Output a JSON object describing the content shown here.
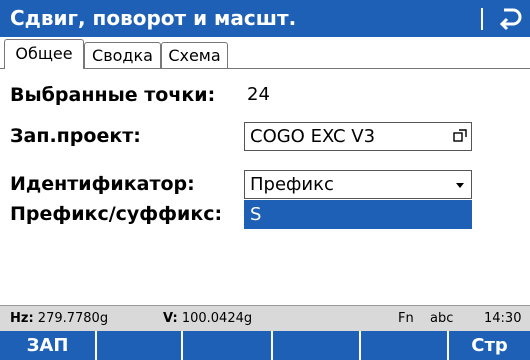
{
  "window": {
    "title": "Сдвиг, поворот и масшт."
  },
  "tabs": [
    {
      "label": "Общее",
      "active": true
    },
    {
      "label": "Сводка",
      "active": false
    },
    {
      "label": "Схема",
      "active": false
    }
  ],
  "form": {
    "selected_points": {
      "label": "Выбранные точки:",
      "value": "24"
    },
    "job": {
      "label": "Зап.проект:",
      "value": "COGO EXC V3"
    },
    "identifier": {
      "label": "Идентификатор:",
      "value": "Префикс"
    },
    "prefix_suffix": {
      "label": "Префикс/суффикс:",
      "value": "S"
    }
  },
  "status": {
    "hz_label": "Hz:",
    "hz_value": "279.7780g",
    "v_label": "V:",
    "v_value": "100.0424g",
    "fn": "Fn",
    "input_mode": "abc",
    "time": "14:30"
  },
  "softkeys": [
    "ЗАП",
    "",
    "",
    "",
    "",
    "Стр"
  ],
  "colors": {
    "accent": "#1d60b5",
    "statusbar": "#d9d9d9"
  }
}
